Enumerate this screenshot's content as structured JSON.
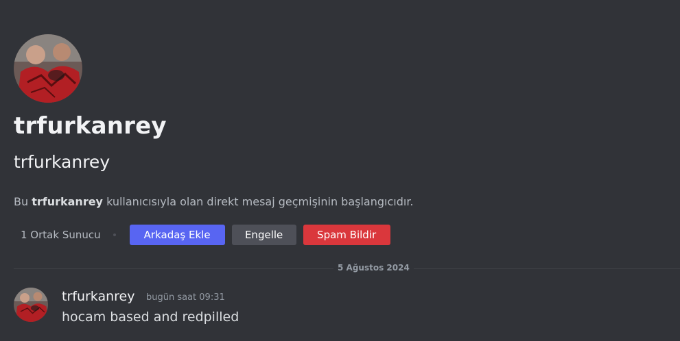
{
  "profile": {
    "display_name": "trfurkanrey",
    "username": "trfurkanrey",
    "intro_prefix": "Bu ",
    "intro_name": "trfurkanrey",
    "intro_suffix": " kullanıcısıyla olan direkt mesaj geçmişinin başlangıcıdır.",
    "mutual_servers": "1 Ortak Sunucu",
    "buttons": {
      "add_friend": "Arkadaş Ekle",
      "block": "Engelle",
      "report_spam": "Spam Bildir"
    }
  },
  "date_divider": "5 Ağustos 2024",
  "messages": [
    {
      "author": "trfurkanrey",
      "timestamp": "bugün saat 09:31",
      "text": "hocam based and redpilled"
    }
  ],
  "colors": {
    "background": "#313338",
    "accent": "#5865f2",
    "danger": "#da373c",
    "secondary": "#4e5058"
  }
}
